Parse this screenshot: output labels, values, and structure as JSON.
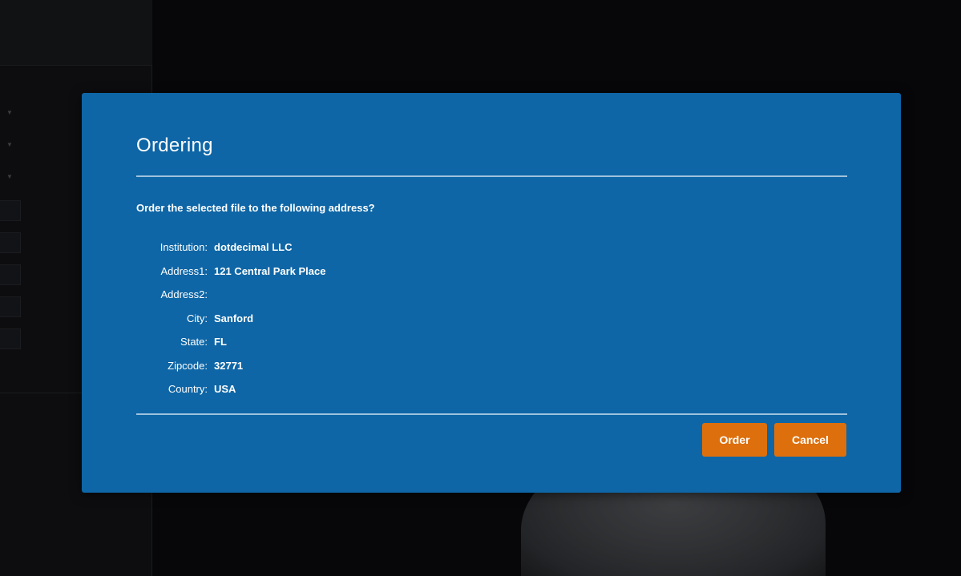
{
  "dialog": {
    "title": "Ordering",
    "prompt": "Order the selected file to the following address?",
    "address": [
      {
        "label": "Institution:",
        "value": "dotdecimal LLC"
      },
      {
        "label": "Address1:",
        "value": "121 Central Park Place"
      },
      {
        "label": "Address2:",
        "value": ""
      },
      {
        "label": "City:",
        "value": "Sanford"
      },
      {
        "label": "State:",
        "value": "FL"
      },
      {
        "label": "Zipcode:",
        "value": "32771"
      },
      {
        "label": "Country:",
        "value": "USA"
      }
    ],
    "buttons": {
      "order_label": "Order",
      "cancel_label": "Cancel"
    }
  },
  "colors": {
    "dialog_bg": "#0e66a6",
    "button_bg": "#dd6f0c",
    "app_bg": "#0c0d10"
  },
  "icons": {
    "left_panel_dropdown": "chevron-down-icon"
  }
}
